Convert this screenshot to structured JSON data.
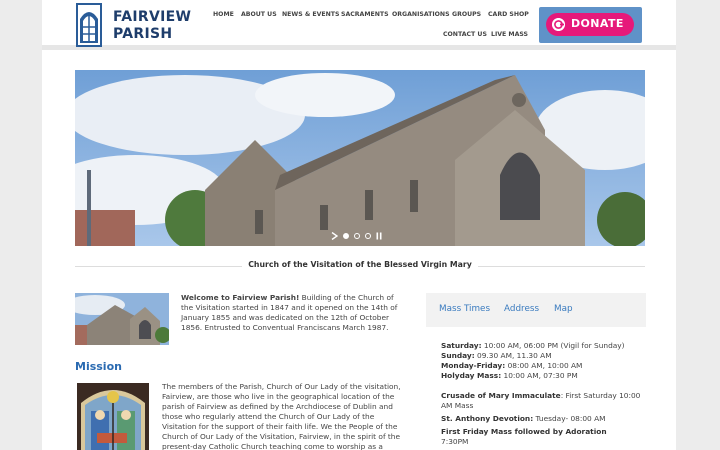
{
  "brand": {
    "line1": "FAIRVIEW",
    "line2": "PARISH"
  },
  "nav": {
    "items": [
      {
        "label": "HOME"
      },
      {
        "label": "ABOUT US"
      },
      {
        "label": "NEWS & EVENTS"
      },
      {
        "label": "SACRAMENTS"
      },
      {
        "label": "ORGANISATIONS"
      },
      {
        "label": "GROUPS"
      },
      {
        "label": "CARD SHOP"
      },
      {
        "label": "CONTACT US"
      },
      {
        "label": "LIVE MASS"
      }
    ]
  },
  "donate": {
    "label": "DONATE"
  },
  "hero": {
    "caption": "Church of the Visitation of the Blessed Virgin Mary",
    "slide_active": 1,
    "slide_count": 3
  },
  "welcome": {
    "lead": "Welcome to Fairview Parish!",
    "body": " Building of the Church of the Visitation started in 1847 and it opened on the 14th of January 1855 and was dedicated on the 12th of October 1856. Entrusted to Conventual Franciscans March 1987."
  },
  "mission": {
    "title": "Mission",
    "body": "The members of the Parish, Church of Our Lady of the visitation, Fairview, are those who live in the geographical location of the parish of Fairview as defined by the Archdiocese of Dublin and those who regularly attend the Church of Our Lady of the Visitation for the support of their faith life. We the People of the Church of Our Lady of the Visitation, Fairview, in the spirit of the present-day Catholic Church teaching come to worship as a"
  },
  "info_tabs": [
    {
      "label": "Mass Times"
    },
    {
      "label": "Address"
    },
    {
      "label": "Map"
    }
  ],
  "mass_times": {
    "saturday_label": "Saturday:",
    "saturday": " 10:00 AM, 06:00 PM (Vigil for Sunday)",
    "sunday_label": "Sunday:",
    "sunday": " 09.30 AM, 11.30 AM",
    "weekday_label": "Monday-Friday:",
    "weekday": " 08:00 AM, 10:00 AM",
    "holyday_label": "Holyday Mass:",
    "holyday": " 10:00 AM, 07:30 PM",
    "crusade_label": "Crusade of Mary Immaculate",
    "crusade": ": First Saturday 10:00 AM Mass",
    "anthony_label": "St. Anthony Devotion:",
    "anthony": " Tuesday- 08:00 AM",
    "firstfriday_label": "First Friday Mass followed by Adoration",
    "firstfriday": "7:30PM"
  },
  "colors": {
    "brand": "#1e3d6b",
    "accent": "#2a6ab1",
    "donate": "#e6197a",
    "donate_bg": "#5f92c8"
  }
}
